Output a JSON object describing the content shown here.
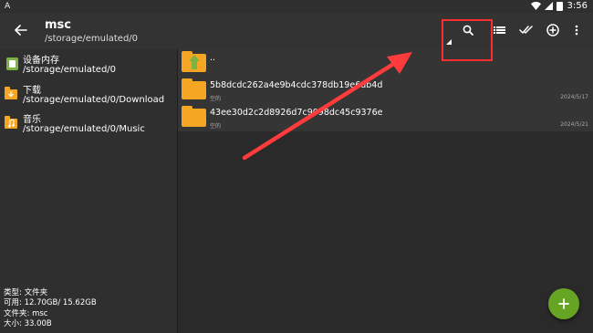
{
  "status_bar": {
    "left_glyph": "A",
    "time": "3:56"
  },
  "toolbar": {
    "title": "msc",
    "path": "/storage/emulated/0"
  },
  "sidebar": {
    "items": [
      {
        "name": "设备内存",
        "path": "/storage/emulated/0",
        "icon": "sd-card-icon"
      },
      {
        "name": "下载",
        "path": "/storage/emulated/0/Download",
        "icon": "download-folder-icon"
      },
      {
        "name": "音乐",
        "path": "/storage/emulated/0/Music",
        "icon": "music-folder-icon"
      }
    ],
    "info": {
      "type_label": "类型:",
      "type_value": "文件夹",
      "avail_label": "可用:",
      "avail_value": "12.70GB/ 15.62GB",
      "folder_label": "文件夹:",
      "folder_value": "msc",
      "size_label": "大小:",
      "size_value": "33.00B"
    }
  },
  "files": [
    {
      "name": "..",
      "sub": "",
      "date": ""
    },
    {
      "name": "5b8dcdc262a4e9b4cdc378db19e6db4d",
      "sub": "空的",
      "date": "2024/5/17"
    },
    {
      "name": "43ee30d2c2d8926d7c9098dc45c9376e",
      "sub": "空的",
      "date": "2024/5/21"
    }
  ],
  "colors": {
    "accent": "#66a524",
    "folder": "#f5a623",
    "annotation": "#ff2d2d"
  }
}
